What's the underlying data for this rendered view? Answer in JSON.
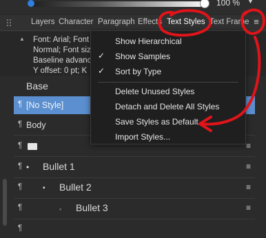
{
  "topbar": {
    "opacity_value": "100 %",
    "opacity_level": 1.0
  },
  "tabs": [
    {
      "label": "Layers"
    },
    {
      "label": "Character"
    },
    {
      "label": "Paragraph"
    },
    {
      "label": "Effects"
    },
    {
      "label": "Text Styles",
      "active": true
    },
    {
      "label": "Text Frame"
    }
  ],
  "info": {
    "lines": [
      "Font: Arial; Font",
      "Normal; Font siz",
      "Baseline advanc",
      "Y offset: 0 pt; K"
    ]
  },
  "list": {
    "rows": [
      {
        "label": "Base",
        "kind": "header"
      },
      {
        "label": "[No Style]",
        "kind": "style",
        "selected": true
      },
      {
        "label": "Body",
        "kind": "style"
      },
      {
        "label": "",
        "kind": "style"
      },
      {
        "label": "Bullet 1",
        "kind": "bullet",
        "bullet": "•"
      },
      {
        "label": "Bullet 2",
        "kind": "bullet",
        "bullet": "▪"
      },
      {
        "label": "Bullet 3",
        "kind": "bullet",
        "bullet": "◦"
      },
      {
        "label": "",
        "kind": "style"
      }
    ]
  },
  "dropdown": {
    "items": [
      {
        "label": "Show Hierarchical",
        "checked": false
      },
      {
        "label": "Show Samples",
        "checked": true
      },
      {
        "label": "Sort by Type",
        "checked": true
      },
      {
        "label": "Delete Unused Styles",
        "checked": false
      },
      {
        "label": "Detach and Delete All Styles",
        "checked": false
      },
      {
        "label": "Save Styles as Default",
        "checked": false
      },
      {
        "label": "Import Styles...",
        "checked": false
      }
    ]
  },
  "icons": {
    "paragraph": "¶",
    "checkmark": "✓",
    "menu": "≡",
    "collapse": "▲",
    "dropdown_arrow": "▼"
  },
  "colors": {
    "background": "#2b2b2b",
    "menu_bg": "#1f1f1f",
    "selection": "#5b8fd0",
    "annotation": "#e0141a",
    "slider_dot": "#2f7fe0"
  }
}
